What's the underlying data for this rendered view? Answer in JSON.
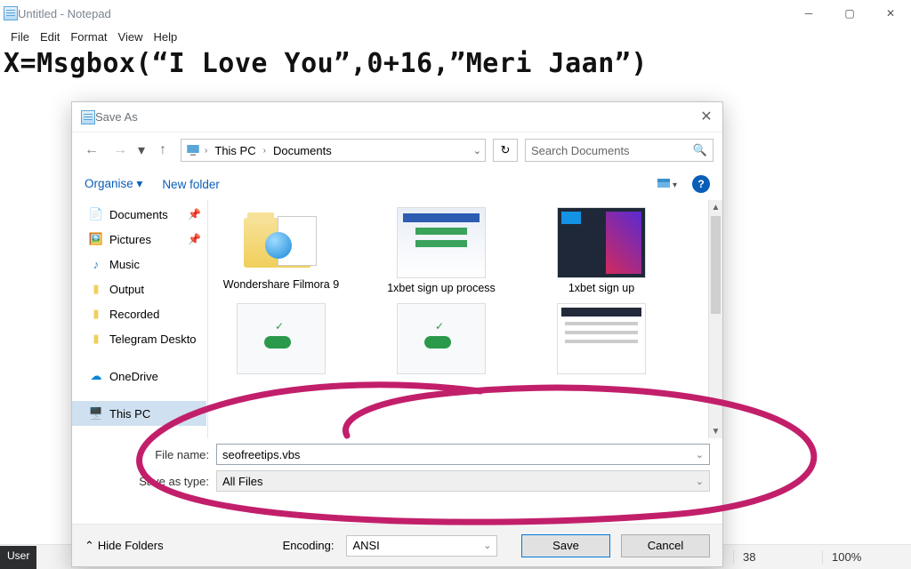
{
  "notepad": {
    "title": "Untitled - Notepad",
    "menu": [
      "File",
      "Edit",
      "Format",
      "View",
      "Help"
    ],
    "content": "X=Msgbox(“I Love You”,0+16,”Meri Jaan”)"
  },
  "statusbar": {
    "col": "38",
    "zoom": "100%"
  },
  "dialog": {
    "title": "Save As",
    "breadcrumb": [
      "This PC",
      "Documents"
    ],
    "search_placeholder": "Search Documents",
    "toolbar": {
      "organise": "Organise",
      "new_folder": "New folder"
    },
    "nav_items": [
      {
        "icon": "doc",
        "label": "Documents",
        "pin": true
      },
      {
        "icon": "pic",
        "label": "Pictures",
        "pin": true
      },
      {
        "icon": "music",
        "label": "Music"
      },
      {
        "icon": "folder",
        "label": "Output"
      },
      {
        "icon": "folder",
        "label": "Recorded"
      },
      {
        "icon": "folder",
        "label": "Telegram Deskto"
      },
      {
        "icon": "cloud",
        "label": "OneDrive",
        "spaced": true
      },
      {
        "icon": "pc",
        "label": "This PC",
        "selected": true,
        "spaced": true
      }
    ],
    "files": [
      {
        "kind": "folder",
        "label": "Wondershare Filmora 9"
      },
      {
        "kind": "image",
        "label": "1xbet sign up process"
      },
      {
        "kind": "image",
        "label": "1xbet sign up"
      }
    ],
    "form": {
      "filename_label": "File name:",
      "filename_value": "seofreetips.vbs",
      "type_label": "Save as type:",
      "type_value": "All Files"
    },
    "footer": {
      "hide_folders": "Hide Folders",
      "encoding_label": "Encoding:",
      "encoding_value": "ANSI",
      "save": "Save",
      "cancel": "Cancel"
    }
  }
}
